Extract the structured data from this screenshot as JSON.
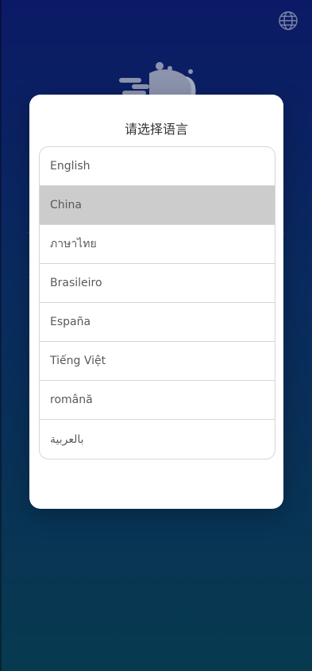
{
  "screen": {
    "background_top": "#0b1a66",
    "background_bottom": "#073a4f"
  },
  "header": {
    "language_icon": "globe-icon"
  },
  "modal": {
    "title": "请选择语言",
    "selected_highlight_color": "#cccccc",
    "languages": [
      {
        "label": "English"
      },
      {
        "label": "China",
        "selected": true
      },
      {
        "label": "ภาษาไทย"
      },
      {
        "label": "Brasileiro"
      },
      {
        "label": "España"
      },
      {
        "label": "Tiếng Việt"
      },
      {
        "label": "română"
      },
      {
        "label": "بالعربية"
      }
    ]
  }
}
